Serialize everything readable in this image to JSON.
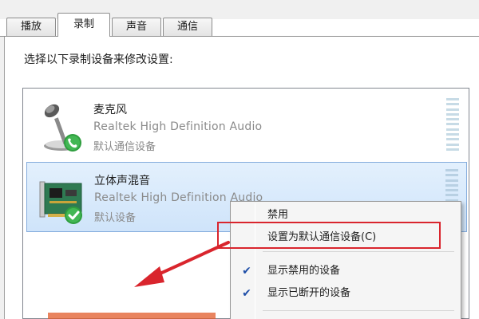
{
  "tabs": [
    {
      "label": "播放",
      "active": false
    },
    {
      "label": "录制",
      "active": true
    },
    {
      "label": "声音",
      "active": false
    },
    {
      "label": "通信",
      "active": false
    }
  ],
  "instruction": "选择以下录制设备来修改设置:",
  "devices": [
    {
      "name": "麦克风",
      "description": "Realtek High Definition Audio",
      "status": "默认通信设备",
      "icon": "microphone-icon",
      "badge": "phone-badge-icon"
    },
    {
      "name": "立体声混音",
      "description": "Realtek High Definition Audio",
      "status": "默认设备",
      "icon": "sound-card-icon",
      "badge": "check-badge-icon",
      "selected": true
    }
  ],
  "context_menu": {
    "items": [
      {
        "label": "禁用",
        "checked": false
      },
      {
        "label": "设置为默认通信设备(C)",
        "checked": false,
        "highlighted": true
      },
      {
        "label": "显示禁用的设备",
        "checked": true
      },
      {
        "label": "显示已断开的设备",
        "checked": true
      }
    ]
  },
  "colors": {
    "accent_red": "#d9252d",
    "selection_blue": "#cfe4fa",
    "check_blue": "#1f4fa8"
  }
}
